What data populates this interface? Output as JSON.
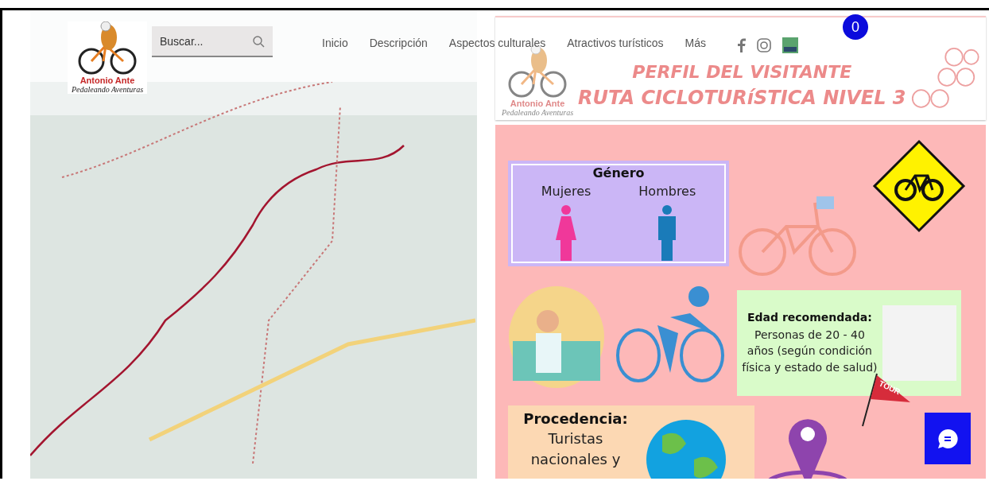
{
  "header": {
    "logo": {
      "title": "Antonio Ante",
      "tagline": "Pedaleando Aventuras"
    },
    "search": {
      "placeholder": "Buscar..."
    },
    "nav": [
      {
        "label": "Inicio"
      },
      {
        "label": "Descripción"
      },
      {
        "label": "Aspectos culturales"
      },
      {
        "label": "Atractivos turísticos"
      },
      {
        "label": "Más"
      }
    ],
    "cart": {
      "count": "0"
    }
  },
  "infographic": {
    "logo": {
      "title": "Antonio Ante",
      "tagline": "Pedaleando Aventuras"
    },
    "title": "PERFIL DEL VISITANTE",
    "subtitle": "RUTA CICLOTURíSTICA NIVEL 3",
    "gender": {
      "heading": "Género",
      "groups": [
        {
          "label": "Mujeres",
          "kind": "female"
        },
        {
          "label": "Hombres",
          "kind": "male"
        }
      ]
    },
    "age": {
      "heading": "Edad recomendada:",
      "text": "Personas de 20 - 40 años (según condición física y estado de salud)"
    },
    "origin": {
      "heading": "Procedencia:",
      "text": "Turistas nacionales y"
    },
    "flag": {
      "label": "TOUR"
    }
  }
}
